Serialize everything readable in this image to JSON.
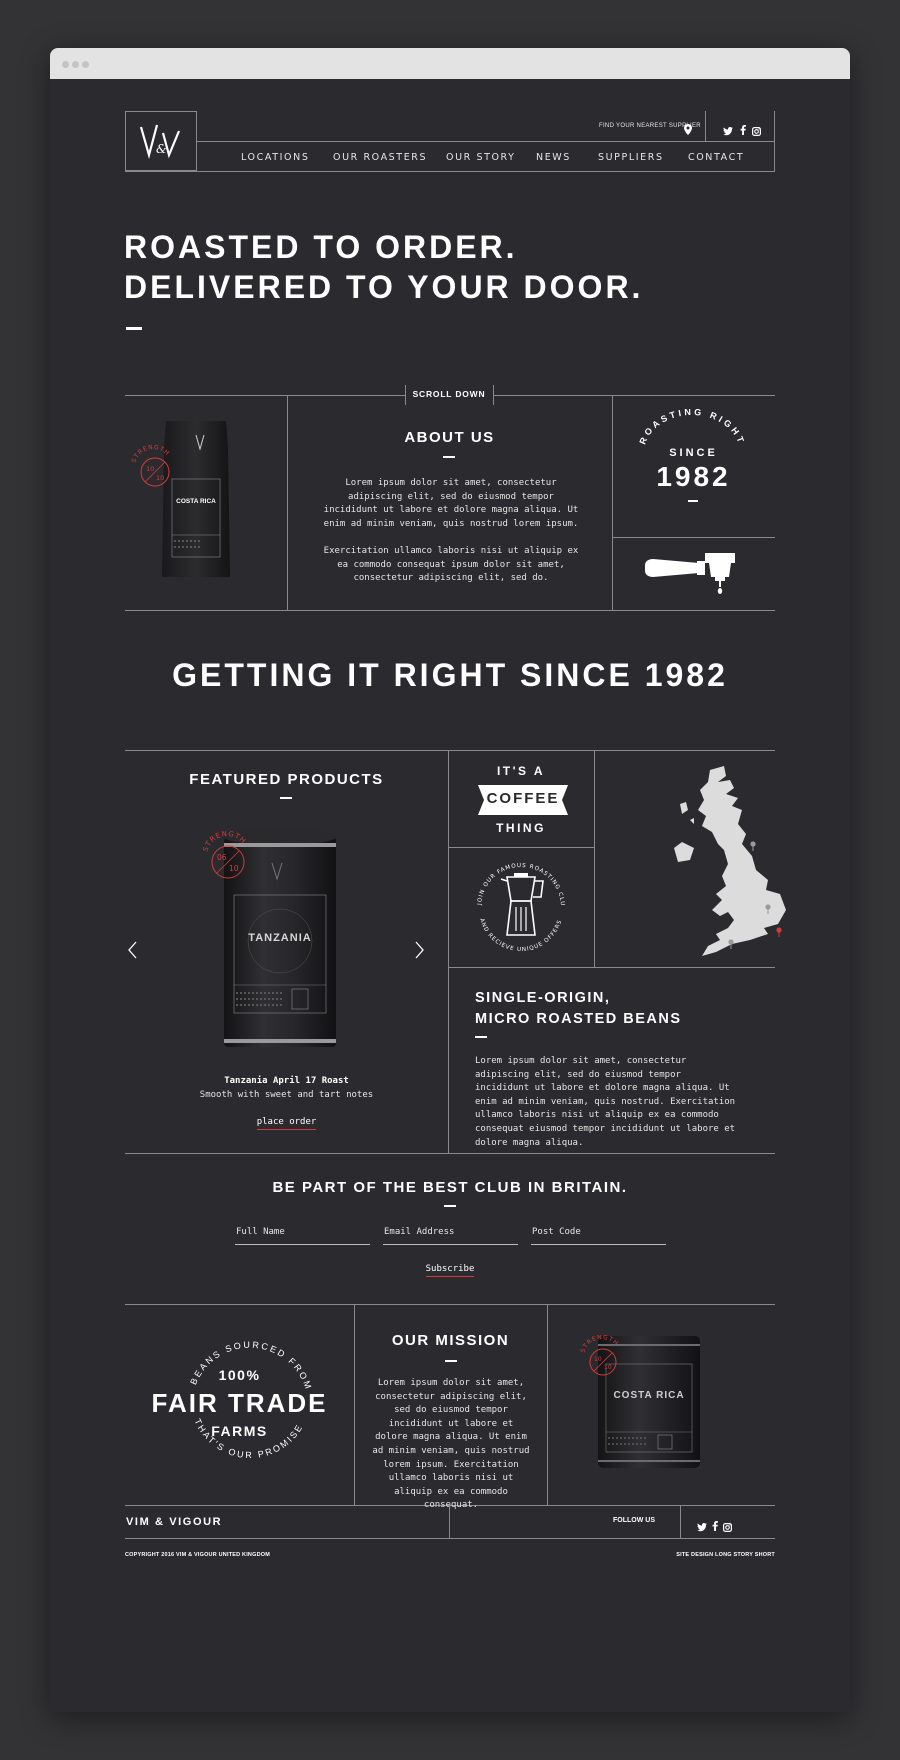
{
  "header": {
    "logo_text": "V&V",
    "find_supplier": "FIND YOUR NEAREST SUPPLIER",
    "nav": [
      "LOCATIONS",
      "OUR ROASTERS",
      "OUR STORY",
      "NEWS",
      "SUPPLIERS",
      "CONTACT"
    ]
  },
  "hero": {
    "line1": "ROASTED TO ORDER.",
    "line2": "DELIVERED TO YOUR DOOR."
  },
  "scroll_down": "SCROLL DOWN",
  "bag1": {
    "label": "COSTA RICA",
    "strength_word": "STRENGTH",
    "strength_value": "10",
    "strength_max": "10"
  },
  "about": {
    "title": "ABOUT US",
    "p1": "Lorem ipsum dolor sit amet, consectetur adipiscing elit, sed do eiusmod tempor incididunt ut labore et dolore magna aliqua. Ut enim ad minim veniam, quis nostrud lorem ipsum.",
    "p2": "Exercitation ullamco laboris nisi ut aliquip ex ea commodo consequat ipsum dolor sit amet, consectetur adipiscing elit, sed do."
  },
  "badge1982": {
    "arc": "ROASTING RIGHT",
    "since": "SINCE",
    "year": "1982"
  },
  "tagline": "GETTING IT RIGHT SINCE 1982",
  "featured": {
    "title": "FEATURED PRODUCTS",
    "tin_label": "TANZANIA",
    "strength_word": "STRENGTH",
    "strength_value": "06",
    "strength_max": "10",
    "product_name": "Tanzania April 17 Roast",
    "product_desc": "Smooth with sweet and tart notes",
    "order_label": "place order"
  },
  "coffee_thing": {
    "its_a": "IT'S A",
    "coffee": "COFFEE",
    "thing": "THING"
  },
  "club_badge": {
    "top_arc": "JOIN OUR FAMOUS ROASTING CLUB",
    "bottom_arc": "AND RECIEVE UNIQUE OFFERS"
  },
  "single_origin": {
    "title1": "SINGLE-ORIGIN,",
    "title2": "MICRO ROASTED BEANS",
    "body": "Lorem ipsum dolor sit amet, consectetur adipiscing elit, sed do eiusmod tempor incididunt ut labore et dolore magna aliqua. Ut enim ad minim veniam, quis nostrud. Exercitation ullamco laboris nisi ut aliquip ex ea commodo consequat eiusmod tempor incididunt ut labore et dolore magna aliqua."
  },
  "club": {
    "title": "BE PART OF THE BEST CLUB IN BRITAIN.",
    "full_name": "Full Name",
    "email": "Email Address",
    "post_code": "Post Code",
    "subscribe": "Subscribe"
  },
  "fair_trade": {
    "top_arc": "BEANS SOURCED FROM",
    "percent": "100%",
    "fair_trade": "FAIR TRADE",
    "farms": "FARMS",
    "bottom_arc": "THAT'S OUR PROMISE"
  },
  "mission": {
    "title": "OUR MISSION",
    "body": "Lorem ipsum dolor sit amet, consectetur adipiscing elit, sed do eiusmod tempor incididunt ut labore et dolore magna aliqua. Ut enim ad minim veniam, quis nostrud lorem ipsum. Exercitation ullamco laboris nisi ut aliquip ex ea commodo consequat."
  },
  "tin2": {
    "label": "COSTA RICA",
    "strength_word": "STRENGTH",
    "strength_value": "10",
    "strength_max": "10"
  },
  "footer": {
    "brand": "VIM & VIGOUR",
    "follow": "FOLLOW US",
    "copyright": "COPYRIGHT 2016 VIM & VIGOUR UNITED KINGDOM",
    "credit": "SITE DESIGN LONG STORY SHORT"
  },
  "colors": {
    "background": "#2b2b2f",
    "accent_red": "#d23b3b",
    "line": "#8a8a8e"
  }
}
